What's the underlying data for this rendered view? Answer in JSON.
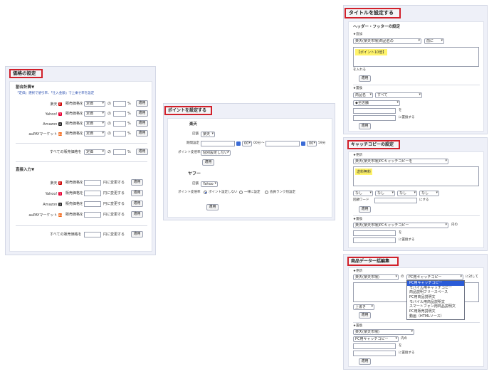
{
  "price": {
    "title": "価格の設定",
    "ratio_header": "割合計算▼",
    "ratio_note": "「定価」選択で値引率、「仕入金額」で上乗せ率を設定",
    "ratio_rows": [
      {
        "store": "楽天",
        "label": "販売価格を",
        "select": "定価",
        "mid": "の",
        "unit": "%",
        "btn": "適用"
      },
      {
        "store": "Yahoo!",
        "label": "販売価格を",
        "select": "定価",
        "mid": "の",
        "unit": "%",
        "btn": "適用"
      },
      {
        "store": "Amazon",
        "label": "販売価格を",
        "select": "定価",
        "mid": "の",
        "unit": "%",
        "btn": "適用"
      },
      {
        "store": "auPAYマーケット",
        "label": "販売価格を",
        "select": "定価",
        "mid": "の",
        "unit": "%",
        "btn": "適用"
      }
    ],
    "ratio_all": {
      "label": "すべての販売価格を",
      "select": "定価",
      "mid": "の",
      "unit": "%",
      "btn": "適用"
    },
    "direct_header": "直接入力▼",
    "direct_rows": [
      {
        "store": "楽天",
        "label": "販売価格を",
        "suffix": "円に変更する",
        "btn": "適用"
      },
      {
        "store": "Yahoo!",
        "label": "販売価格を",
        "suffix": "円に変更する",
        "btn": "適用"
      },
      {
        "store": "Amazon",
        "label": "販売価格を",
        "suffix": "円に変更する",
        "btn": "適用"
      },
      {
        "store": "auPAYマーケット",
        "label": "販売価格を",
        "suffix": "円に変更する",
        "btn": "適用"
      }
    ],
    "direct_all": {
      "label": "すべての販売価格を",
      "suffix": "円に変更する",
      "btn": "適用"
    }
  },
  "points": {
    "title": "ポイントを設定する",
    "rakuten": {
      "heading": "楽天",
      "store_label": "店舗",
      "store_value": "楽天",
      "period_label": "期間設定",
      "hour1": "00",
      "min1": "00分",
      "tilde": "〜",
      "hour2": "00",
      "min2": "59分",
      "rate_label": "ポイント変倍率",
      "rate_value": "個別設定しない",
      "btn": "適用"
    },
    "yahoo": {
      "heading": "ヤフー",
      "store_label": "店舗",
      "store_value": "Yahoo",
      "rate_label": "ポイント変倍率",
      "opt1": "ポイント設定しない",
      "opt2": "一律に設定",
      "opt3": "会員ランク別設定",
      "btn": "適用"
    }
  },
  "title_panel": {
    "title": "タイトルを設定する",
    "section": "ヘッダー・フッターの設定",
    "add_label": "★追加",
    "add_select": "楽天(楽天市場)商品名の",
    "add_pos": "前に",
    "add_text": "【ポイント10倍】",
    "add_suffix": "を入れる",
    "add_btn": "適用",
    "replace_label": "★置換",
    "rep_sel1": "商品名",
    "rep_sel2": "すべて",
    "rep_sel3": "◆全店舗",
    "rep_suffix1": "を",
    "rep_suffix2": "に置換する",
    "rep_btn": "適用"
  },
  "catch_panel": {
    "title": "キャッチコピーの設定",
    "change_label": "★更新",
    "change_select": "楽天(楽天市場)PCキャッチコピーを",
    "change_text": "送料無料",
    "none1": "なし",
    "none2": "なし",
    "none3": "なし",
    "none4": "なし",
    "kw_label": "回顧ワード",
    "kw_suffix": "にする",
    "change_btn": "適用",
    "replace_label": "★置換",
    "rep_select": "楽天(楽天市場)PCキャッチコピー",
    "rep_mid": "内の",
    "rep_suffix1": "を",
    "rep_suffix2": "に置換する",
    "rep_btn": "適用"
  },
  "bulk_panel": {
    "title": "商品データ一括編集",
    "change_label": "★更新",
    "change_select": "楽天(楽天市場)",
    "change_of": "の",
    "field_select": "PC用キャッチコピー",
    "change_suffix": "に対して",
    "dropdown_options": [
      "PC用キャッチコピー",
      "モバイル用キャッチコピー",
      "商品説明フリースペース",
      "PC用商品説明文",
      "モバイル用商品説明文",
      "スマートフォン用商品説明文",
      "PC用販売説明文",
      "動画（HTMLソース）"
    ],
    "overwrite": "上書き",
    "change_btn": "適用",
    "replace_label": "★置換",
    "rep_select": "楽天(楽天市場)",
    "rep_field": "PC用キャッチコピー",
    "rep_mid": "内の",
    "rep_suffix1": "を",
    "rep_suffix2": "に置換する",
    "rep_btn": "適用"
  },
  "colors": {
    "accent_border": "#d1202a",
    "highlight": "#fff36a",
    "selected_option": "#2a5bd7"
  }
}
